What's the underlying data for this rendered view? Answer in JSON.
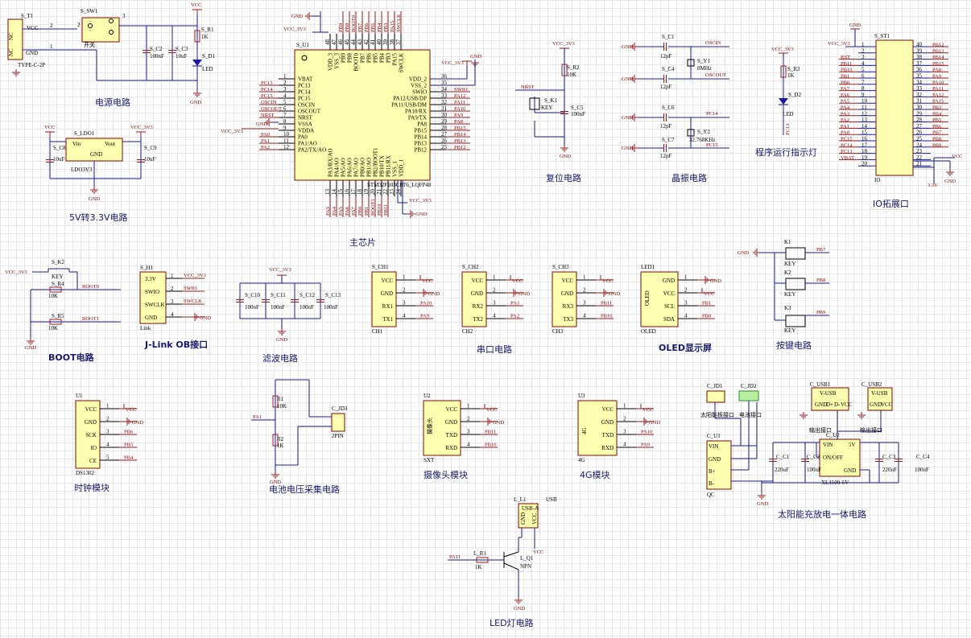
{
  "titles": {
    "power": "电源电路",
    "ldo": "5V转3.3V电路",
    "mcu": "主芯片",
    "reset": "复位电路",
    "crystal": "晶振电路",
    "led_run": "程序运行指示灯",
    "io": "IO拓展口",
    "boot": "BOOT电路",
    "jlink": "J-Link OB接口",
    "filter": "滤波电路",
    "uart": "串口电路",
    "oled": "OLED显示屏",
    "keys": "按键电路",
    "clock": "时钟模块",
    "battery": "电池电压采集电路",
    "camera": "摄像头模块",
    "lte": "4G模块",
    "solar": "太阳能充放电一体电路",
    "led_lamp": "LED灯电路"
  },
  "power": {
    "connector_ref": "S_T1",
    "connector_type": "TYPE-C-2P",
    "pins": [
      "NC",
      "VCC",
      "GND",
      "NC"
    ],
    "switch_ref": "S_SW1",
    "switch_label": "开关",
    "c2": "S_C2",
    "c2_val": "100nF",
    "c3": "S_C3",
    "c3_val": "10uF",
    "r1": "S_R1",
    "r1_val": "1K",
    "d1": "S_D1",
    "d1_label": "LED",
    "vcc": "VCC",
    "gnd": "GND",
    "num1": "1",
    "num2": "2",
    "num3": "3"
  },
  "ldo": {
    "ref": "S_LDO1",
    "vin": "Vin",
    "vout": "Vout",
    "gnd": "GND",
    "part": "LDO3V3",
    "c8": "S_C8",
    "c8_val": "10uF",
    "c9": "S_C9",
    "c9_val": "10uF",
    "vcc": "VCC",
    "vcc33": "VCC_3V3",
    "gnd_lbl": "GND"
  },
  "mcu": {
    "ref": "S_U1",
    "part": "STM32F103C8T6_LQFP48",
    "vcc33": "VCC_3V3",
    "gnd": "GND",
    "left_pins": [
      "VBAT",
      "PC13",
      "PC14",
      "PC15",
      "OSCIN",
      "OSCOUT",
      "NRST",
      "VSSA",
      "VDDA",
      "PA0",
      "PA1/AO",
      "PA2/TX/AO"
    ],
    "left_nums": [
      "1",
      "2",
      "3",
      "4",
      "5",
      "6",
      "7",
      "8",
      "9",
      "10",
      "11",
      "12"
    ],
    "left_nets": [
      "",
      "PC13",
      "PC14",
      "PC15",
      "OSCIN",
      "OSCOUT",
      "NRST",
      "GND",
      "VCC_3V3",
      "PA0",
      "PA1",
      "PA2"
    ],
    "right_pins": [
      "VDD_2",
      "VSS_2",
      "SWIO",
      "PA12/USB/DP",
      "PA11/USB/DM",
      "PA10/RX",
      "PA9/TX",
      "PA8",
      "PB15",
      "PB14",
      "PB13",
      "PB12"
    ],
    "right_nums": [
      "36",
      "35",
      "34",
      "33",
      "32",
      "31",
      "30",
      "29",
      "28",
      "27",
      "26",
      "25"
    ],
    "right_nets": [
      "VCC_3V3",
      "",
      "SWIO",
      "PA12",
      "PA11",
      "PA10",
      "PA9",
      "PA8",
      "PB15",
      "PB14",
      "PB13",
      "PB12"
    ],
    "top_pins": [
      "VDD_3",
      "VSS_3",
      "PB9",
      "PB8",
      "BOOT0",
      "PB7",
      "PB6",
      "PB5",
      "PB4",
      "PB3",
      "PA15",
      "SWCLK"
    ],
    "top_nums": [
      "48",
      "47",
      "46",
      "45",
      "44",
      "43",
      "42",
      "41",
      "40",
      "39",
      "38",
      "37"
    ],
    "top_nets": [
      "",
      "",
      "PB9",
      "PB8",
      "BOOT0",
      "PB7",
      "PB6",
      "PB5",
      "PB4",
      "PB3",
      "PA15",
      "SWCLK"
    ],
    "bottom_pins": [
      "PA3/RX/AO",
      "PA4/AO",
      "PA5/AO",
      "PA6/AO",
      "PA7/AO",
      "PB0/AO",
      "PB1/AO",
      "PB2/BOOT1",
      "PB10/TX",
      "PB11/RX",
      "VSS_1",
      "VDD_1"
    ],
    "bottom_nums": [
      "13",
      "14",
      "15",
      "16",
      "17",
      "18",
      "19",
      "20",
      "21",
      "22",
      "23",
      "24"
    ],
    "bottom_nets": [
      "PA3",
      "PA4",
      "PA5",
      "PA6",
      "PA7",
      "PB0",
      "PB1",
      "BOOT1",
      "PB10",
      "PB11",
      "",
      ""
    ]
  },
  "reset": {
    "vcc33": "VCC_3V3",
    "r2": "S_R2",
    "r2_val": "10K",
    "key": "S_K1",
    "key_lbl": "KEY",
    "nrst": "NRST",
    "c5": "S_C5",
    "c5_val": "100nF",
    "gnd": "GND"
  },
  "crystal": {
    "c1": "S_C1",
    "c4": "S_C4",
    "c6": "S_C6",
    "c7": "S_C7",
    "cap_val": "12pF",
    "y1": "S_Y1",
    "y1_val": "8MHz",
    "y2": "S_Y2",
    "y2_val": "32.768KHz",
    "oscin": "OSCIN",
    "oscout": "OSCOUT",
    "pc14": "PC14",
    "pc15": "PC15",
    "gnd": "GND"
  },
  "led_run": {
    "vcc33": "VCC_3V3",
    "r3": "S_R3",
    "r3_val": "1K",
    "d2": "S_D2",
    "d2_lbl": "LED",
    "net": "PC13"
  },
  "io": {
    "ref": "S_ST1",
    "part": "IO",
    "gnd": "GND",
    "vcc33": "VCC_3V3",
    "vcc": "VCC",
    "v33": "3.3V",
    "left_nets": [
      "",
      "",
      "RST",
      "PB11",
      "PB10",
      "PB1",
      "PB0",
      "PA7",
      "PA6",
      "PA5",
      "PA4",
      "PA3",
      "PA2",
      "PA1",
      "PA0",
      "PC15",
      "PC14",
      "PC13",
      "VBAT",
      ""
    ],
    "right_nets": [
      "PB12",
      "PB13",
      "PB14",
      "PB15",
      "PA8",
      "PA9",
      "PA10",
      "PA11",
      "PA12",
      "PA15",
      "PB3",
      "PB4",
      "PB5",
      "PB6",
      "PB7",
      "PB8",
      "PB9",
      "",
      "",
      ""
    ],
    "left_nums": [
      "1",
      "2",
      "3",
      "4",
      "5",
      "6",
      "7",
      "8",
      "9",
      "10",
      "11",
      "12",
      "13",
      "14",
      "15",
      "16",
      "17",
      "18",
      "19",
      "20"
    ],
    "right_nums": [
      "40",
      "39",
      "38",
      "37",
      "36",
      "35",
      "34",
      "33",
      "32",
      "31",
      "30",
      "29",
      "28",
      "27",
      "26",
      "25",
      "24",
      "23",
      "22",
      "21"
    ]
  },
  "boot": {
    "vcc33": "VCC_3V3",
    "k2": "S_K2",
    "key": "KEY",
    "r4": "S_R4",
    "r4_val": "10K",
    "r5": "S_R5",
    "r5_val": "10K",
    "boot0": "BOOT0",
    "boot1": "BOOT1",
    "gnd": "GND"
  },
  "jlink": {
    "ref": "S_H1",
    "part": "Link",
    "pins": [
      "3.3V",
      "SWIO",
      "SWCLK",
      "GND"
    ],
    "nums": [
      "1",
      "2",
      "3",
      "4"
    ],
    "nets": [
      "VCC_3V3",
      "SWIO",
      "SWCLK",
      "GND"
    ]
  },
  "filter": {
    "vcc33": "VCC_3V3",
    "caps": [
      "S_C10",
      "S_C11",
      "S_C12",
      "S_C13"
    ],
    "val": "100nF",
    "gnd": "GND"
  },
  "uart": [
    {
      "ref": "S_CH1",
      "part": "CH1",
      "pins": [
        "VCC",
        "GND",
        "RX1",
        "TX1"
      ],
      "nets": [
        "VCC",
        "GND",
        "PA10",
        "PA9"
      ]
    },
    {
      "ref": "S_CH2",
      "part": "CH2",
      "pins": [
        "VCC",
        "GND",
        "RX2",
        "TX2"
      ],
      "nets": [
        "VCC",
        "GND",
        "PA3",
        "PA2"
      ]
    },
    {
      "ref": "S_CH3",
      "part": "CH3",
      "pins": [
        "VCC",
        "GND",
        "RX3",
        "TX3"
      ],
      "nets": [
        "VCC",
        "GND",
        "PB11",
        "PB10"
      ]
    }
  ],
  "uart_nums": [
    "1",
    "2",
    "3",
    "4"
  ],
  "oled": {
    "ref": "LED1",
    "part": "OLED",
    "side": "OLED",
    "pins": [
      "GND",
      "VCC",
      "SCL",
      "SDA"
    ],
    "nets": [
      "GND",
      "VCC",
      "PB1",
      "PB0"
    ]
  },
  "keys": {
    "gnd": "GND",
    "refs": [
      "K1",
      "K2",
      "K3"
    ],
    "lbl": "KEY",
    "nets": [
      "PB7",
      "PB8",
      "PB9"
    ]
  },
  "clock": {
    "ref": "U1",
    "part": "DS1302",
    "pins": [
      "VCC",
      "GND",
      "SCK",
      "IO",
      "CE"
    ],
    "nets": [
      "VCC",
      "GND",
      "PB6",
      "PB5",
      "PB4"
    ]
  },
  "battery": {
    "r1": "R1",
    "r1_val": "10K",
    "r2": "R2",
    "r2_val": "1K",
    "net": "PA1",
    "jd": "C_JD3",
    "jd_part": "2PIN",
    "gnd": "GND"
  },
  "camera": {
    "ref": "U2",
    "part": "SXT",
    "side": "摄像头",
    "pins": [
      "VCC",
      "GND",
      "TXD",
      "RXD"
    ],
    "nets": [
      "VCC",
      "GND",
      "PB11",
      "PB10"
    ]
  },
  "lte": {
    "ref": "U3",
    "part": "4G",
    "side": "4G",
    "pins": [
      "VCC",
      "GND",
      "TXD",
      "RXD"
    ],
    "nets": [
      "VCC",
      "GND",
      "PA10",
      "PA9"
    ]
  },
  "solar": {
    "jd1": "C_JD1",
    "jd1_lbl": "太阳能板接口",
    "jd2": "C_JD2",
    "jd2_lbl": "电池接口",
    "usb1": "C_USB1",
    "usb2": "C_USB2",
    "usb_lbl": "V-USB",
    "usb_out": "输出接口",
    "usb_pins": [
      "GND",
      "D+",
      "D-",
      "VCC"
    ],
    "u1": "C_U1",
    "u1_part": "QC",
    "u1_pins": [
      "VIN",
      "GND",
      "B+",
      "B-"
    ],
    "u2": "C_U2",
    "u2_part": "XL1509-5V",
    "u2_left": [
      "VIN",
      "ON/OFF"
    ],
    "u2_right": [
      "5V",
      "GND"
    ],
    "c1": "C_C1",
    "c1_val": "220uF",
    "c2": "C_C2",
    "c2_val": "100nF",
    "c3": "C_C3",
    "c3_val": "220uF",
    "c4": "C_C4",
    "c4_val": "100nF",
    "gnd": "GND"
  },
  "led_lamp": {
    "ref": "L_L1",
    "usb": "USB",
    "usb_lbl": "USB-A",
    "usb_pins": [
      "GND",
      "D+",
      "D-",
      "VCC"
    ],
    "r1": "L_R1",
    "r1_val": "1K",
    "q1": "L_Q1",
    "q1_part": "NPN",
    "net": "PA11",
    "vcc": "VCC",
    "gnd": "GND"
  }
}
